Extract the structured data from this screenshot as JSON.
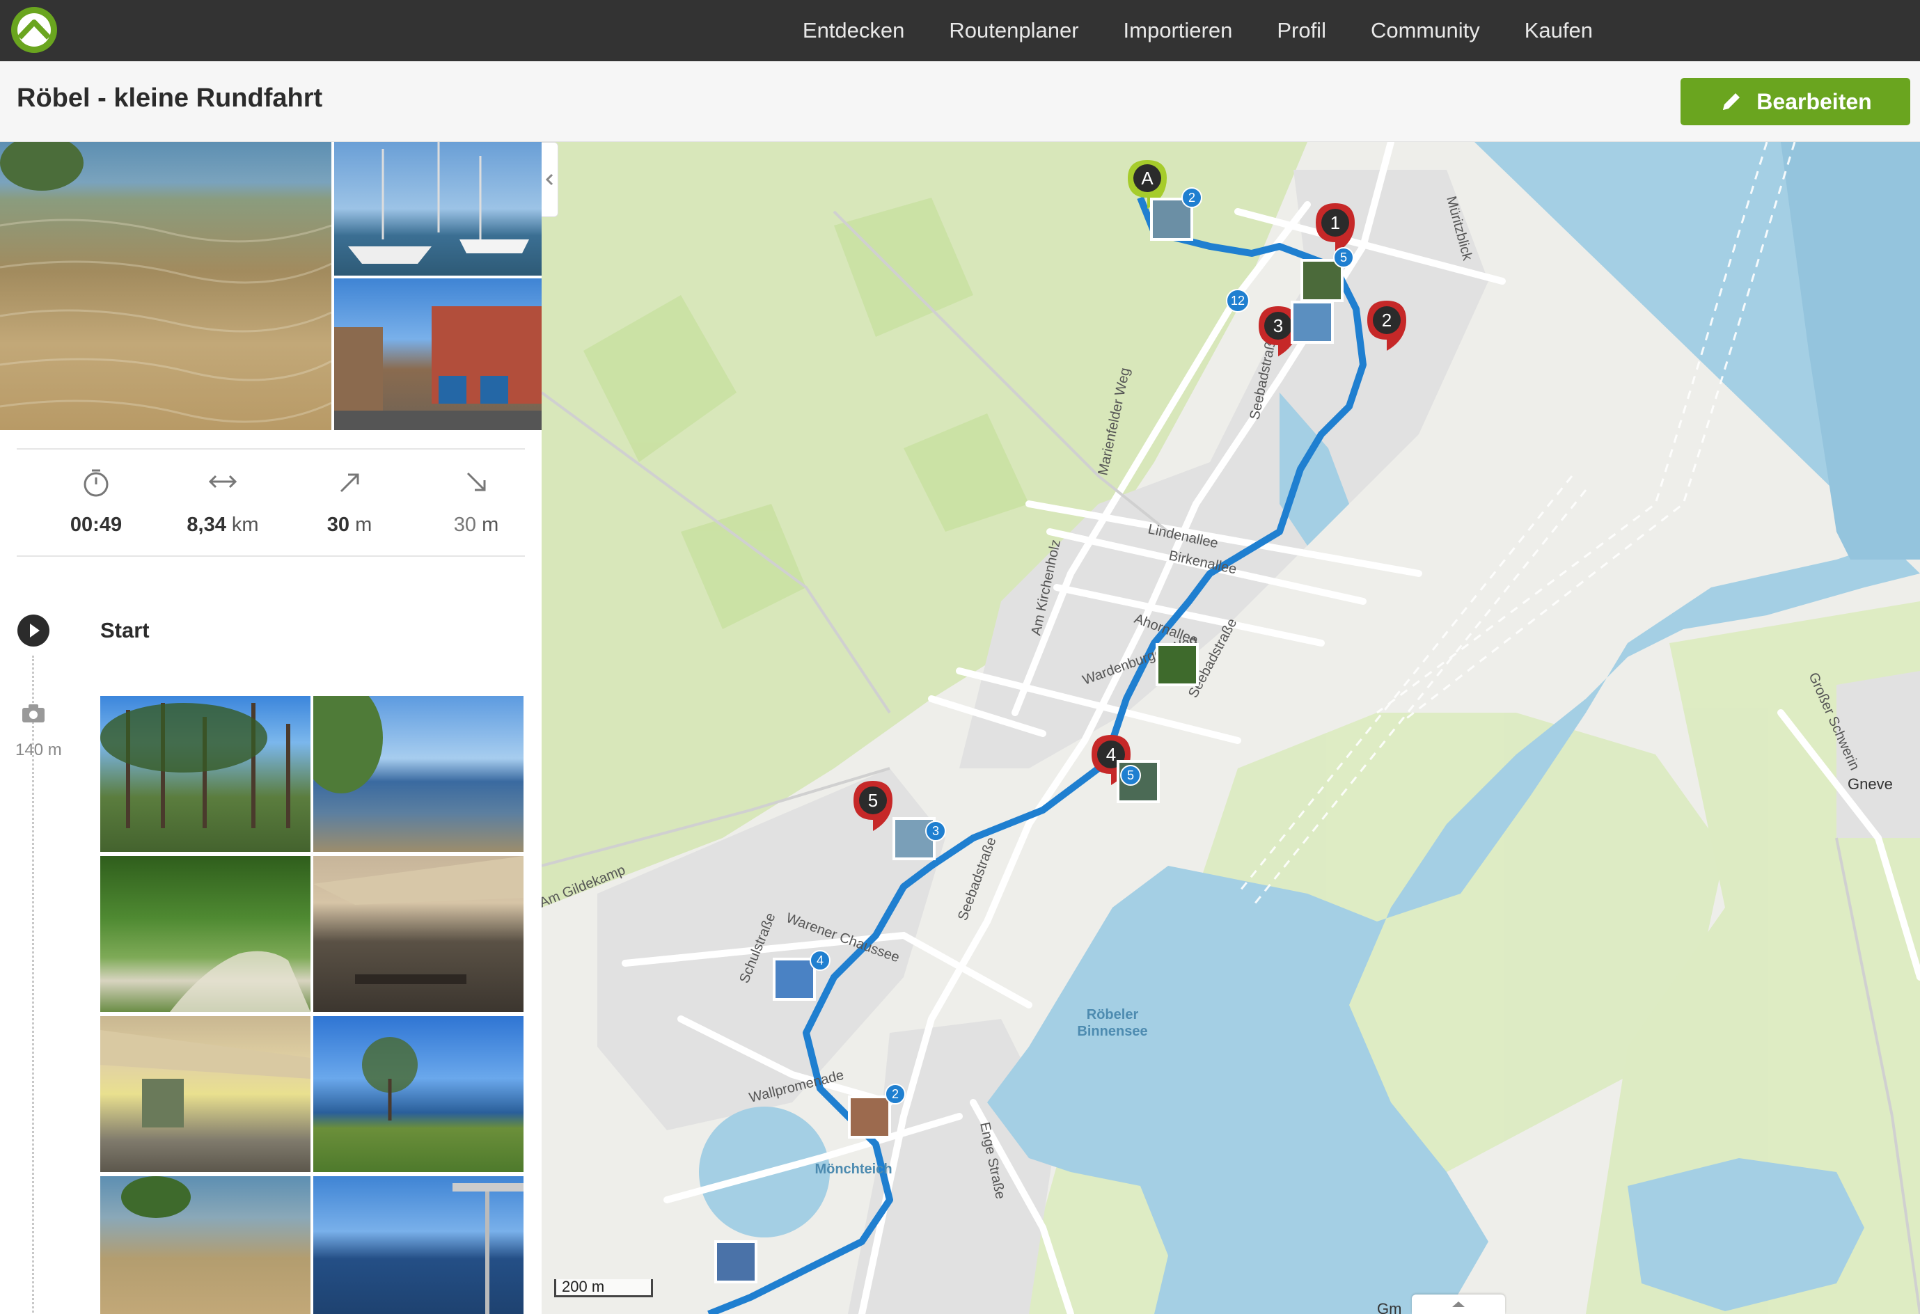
{
  "topbar": {
    "nav": [
      "Entdecken",
      "Routenplaner",
      "Importieren",
      "Profil",
      "Community",
      "Kaufen"
    ]
  },
  "tour": {
    "title": "Röbel - kleine Rundfahrt",
    "edit_label": "Bearbeiten"
  },
  "stats": {
    "duration": "00:49",
    "distance_value": "8,34",
    "distance_unit": "km",
    "uphill_value": "30",
    "uphill_unit": "m",
    "downhill_value": "30",
    "downhill_unit": "m"
  },
  "timeline": {
    "start_label": "Start",
    "photo_distance": "140 m"
  },
  "map": {
    "start_marker": "A",
    "waypoints": [
      "1",
      "2",
      "3",
      "4",
      "5"
    ],
    "photo_counts": [
      "2",
      "5",
      "12",
      "5",
      "3",
      "4",
      "2"
    ],
    "street_labels": [
      "Müritzblick",
      "Seebadstraße",
      "Marienfelder Weg",
      "Lindenallee",
      "Birkenallee",
      "Ahornallee",
      "Am Kirchenholz",
      "Wardenburger Weg",
      "Seebadstraße",
      "Am Gildekamp",
      "Warener Chaussee",
      "Schulstraße",
      "Wallpromenade",
      "Enge Straße",
      "Großer Schwerin",
      "Seebadstraße"
    ],
    "water_labels": [
      "Röbeler",
      "Binnensee",
      "Mönchteich"
    ],
    "place_labels": [
      "Gneve",
      "Gm"
    ],
    "scale_label": "200 m",
    "accent_route": "#1f7fd0",
    "marker_red": "#c62828",
    "marker_start": "#a6cc2b"
  }
}
